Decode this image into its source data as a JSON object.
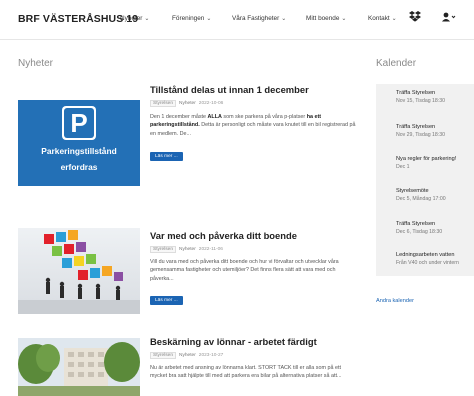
{
  "header": {
    "brand": "BRF VÄSTERÅSHUS 19",
    "nav": [
      {
        "label": "Nyheter"
      },
      {
        "label": "Föreningen"
      },
      {
        "label": "Våra Fastigheter"
      },
      {
        "label": "Mitt boende"
      },
      {
        "label": "Kontakt"
      }
    ],
    "caret": "⌄",
    "dropbox_icon": "dropbox-icon",
    "user_icon": "user-icon"
  },
  "news": {
    "heading": "Nyheter",
    "items": [
      {
        "title": "Tillstånd delas ut innan 1 december",
        "tag": "Styrelsen",
        "category": "Nyheter",
        "date": "2022-10-06",
        "excerpt_1": "Den 1 december måste ",
        "excerpt_bold_1": "ALLA",
        "excerpt_2": " som ske parkera på våra p-platser ",
        "excerpt_bold_2": "ha ett parkeringstillstånd.",
        "excerpt_3": " Detta är personligt och måste vara knutet till en bil registrerad på en medlem. De...",
        "read_more": "Läs mer ...",
        "image_line1": "Parkeringstillstånd",
        "image_line2": "erfordras",
        "image_sign": "P"
      },
      {
        "title": "Var med och påverka ditt boende",
        "tag": "Styrelsen",
        "category": "Nyheter",
        "date": "2022-11-06",
        "excerpt": "Vill du vara med och påverka ditt boende och hur vi förvaltar och utvecklar våra gemensamma fastigheter och utemiljöer? Det finns flera sätt att vara med och påverka...",
        "read_more": "Läs mer ..."
      },
      {
        "title": "Beskärning av lönnar - arbetet färdigt",
        "tag": "Styrelsen",
        "category": "Nyheter",
        "date": "2023-10-27",
        "excerpt": "Nu är arbetet med ansning av lönnarna klart. STORT TACK till er alla som på ett mycket bra satt hjälpte till med att parkera era bilar på alternativa platser så att..."
      }
    ]
  },
  "calendar": {
    "heading": "Kalender",
    "events": [
      {
        "title": "Träffa Styrelsen",
        "date": "Nov 15, Tisdag 18:30"
      },
      {
        "title": "Träffa Styrelsen",
        "date": "Nov 29, Tisdag 18:30"
      },
      {
        "title": "Nya regler för parkering!",
        "date": "Dec 1"
      },
      {
        "title": "Styrelsemöte",
        "date": "Dec 5, Måndag 17:00"
      },
      {
        "title": "Träffa Styrelsen",
        "date": "Dec 6, Tisdag 18:30"
      },
      {
        "title": "Ledningsarbeten vatten",
        "date": "Från V40 och under vintern"
      }
    ],
    "other_link": "Andra kalender"
  },
  "colors": {
    "accent": "#1b64b3",
    "parking_blue": "#2370b6",
    "calendar_bg": "#f1f1f1"
  }
}
